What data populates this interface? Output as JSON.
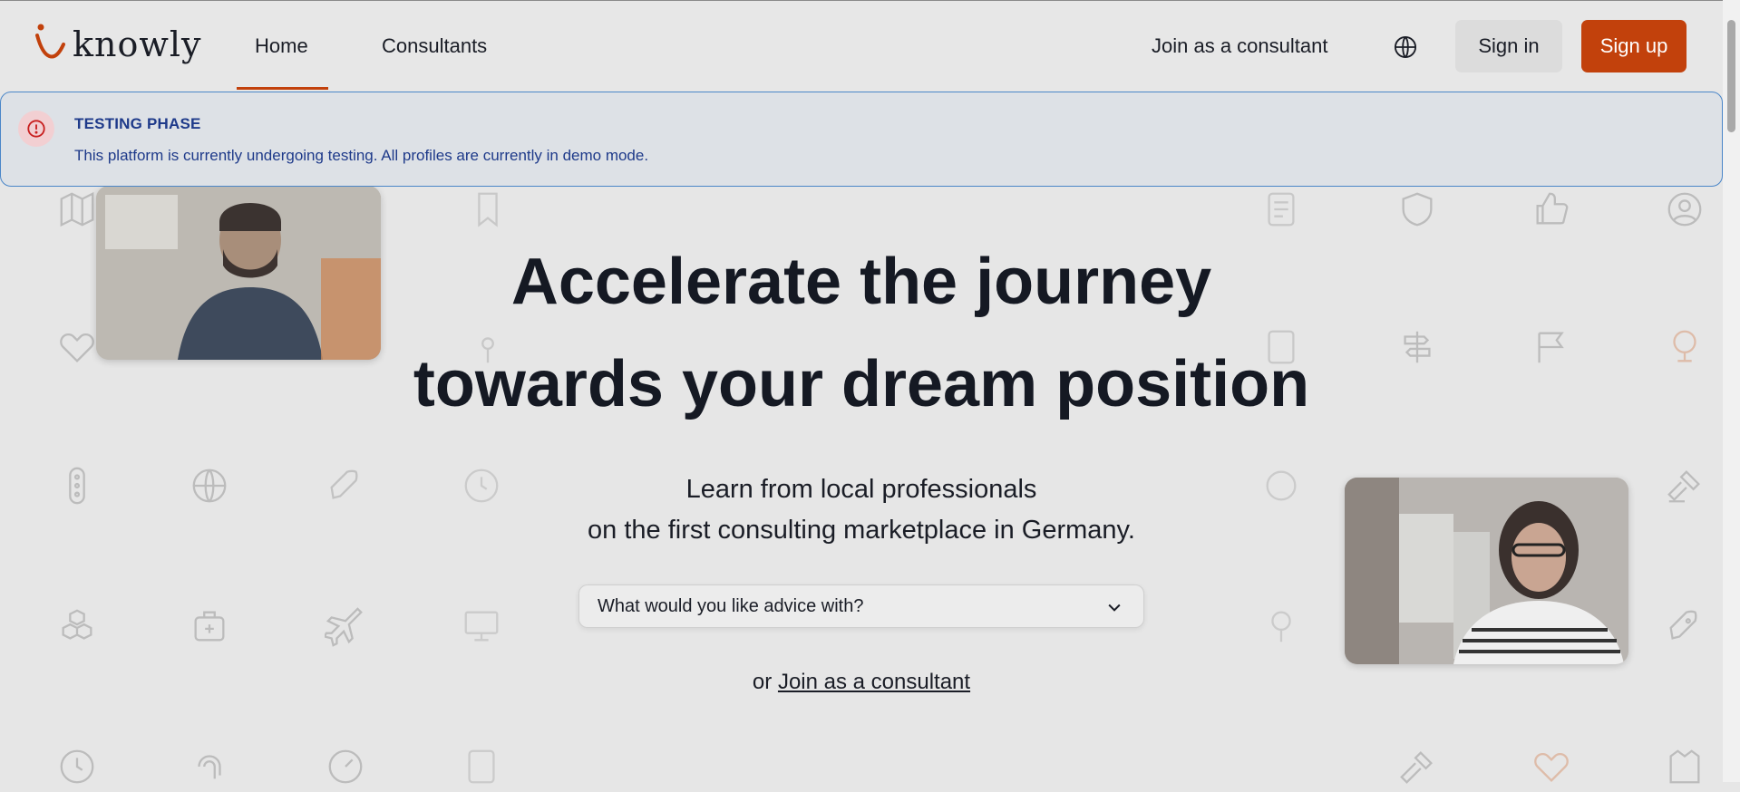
{
  "header": {
    "logo_text": "knowly",
    "nav": [
      {
        "label": "Home",
        "active": true
      },
      {
        "label": "Consultants",
        "active": false
      }
    ],
    "join_label": "Join as a consultant",
    "globe_icon": "globe-icon",
    "signin_label": "Sign in",
    "signup_label": "Sign up"
  },
  "alert": {
    "title": "TESTING PHASE",
    "message": "This platform is currently undergoing testing. All profiles are currently in demo mode.",
    "icon": "alert-circle-icon"
  },
  "hero": {
    "title_line1": "Accelerate the journey",
    "title_line2": "towards your dream position",
    "subtitle_line1": "Learn from local professionals",
    "subtitle_line2": "on the first consulting marketplace in Germany.",
    "select_placeholder": "What would you like advice with?",
    "or_prefix": "or",
    "or_link": "Join as a consultant"
  },
  "colors": {
    "accent": "#c2410c",
    "alert_border": "#4a86c8",
    "alert_text": "#1e3a8a",
    "background": "#e6e6e6"
  }
}
